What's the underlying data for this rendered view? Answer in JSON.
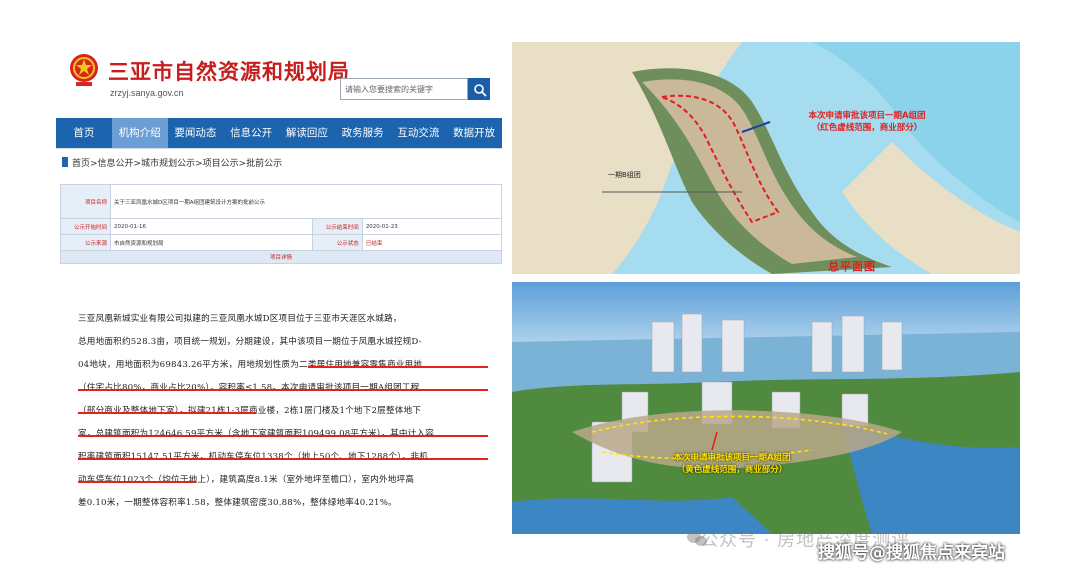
{
  "site": {
    "title": "三亚市自然资源和规划局",
    "domain": "zrzyj.sanya.gov.cn",
    "search_placeholder": "请输入您要搜索的关键字",
    "brand_color": "#c81d1d",
    "nav_color": "#1c64ad"
  },
  "nav": {
    "items": [
      "首页",
      "机构介绍",
      "要闻动态",
      "信息公开",
      "解读回应",
      "政务服务",
      "互动交流",
      "数据开放"
    ],
    "active_index": 1
  },
  "breadcrumb": "首页>信息公开>城市规划公示>项目公示>批前公示",
  "info_table": {
    "rows": [
      {
        "label": "项目名称",
        "value": "关于三亚凤凰水城D区项目一期A组团建筑设计方案的批前公示"
      },
      {
        "label": "公示开始时间",
        "value": "2020-01-16",
        "label2": "公示结束时间",
        "value2": "2020-01-23"
      },
      {
        "label": "公示来源",
        "value": "市自然资源和规划局",
        "label2": "公示状态",
        "value2": "已结束"
      }
    ],
    "detail_label": "项目详情"
  },
  "document": {
    "lines": [
      "三亚凤凰新城实业有限公司拟建的三亚凤凰水城D区项目位于三亚市天涯区水城路，",
      "总用地面积约528.3亩，项目统一规划，分期建设，其中该项目一期位于凤凰水城控规D-",
      "04地块，用地面积为69843.26平方米，用地规划性质为二类居住用地兼容零售商业用地",
      "（住宅占比80%，商业占比20%），容积率≤1.58。本次申请审批该项目一期A组团工程",
      "（部分商业及整体地下室），拟建21栋1-3层商业楼，2栋1层门楼及1个地下2层整体地下",
      "室，总建筑面积为124646.59平方米（含地下室建筑面积109499.08平方米），其中计入容",
      "积率建筑面积15147.51平方米，机动车停车位1338个（地上50个、地下1288个），非机",
      "动车停车位1023个（均位于地上），建筑高度8.1米（室外地坪至檐口），室内外地坪高",
      "差0.10米，一期整体容积率1.58，整体建筑密度30.88%，整体绿地率40.21%。"
    ]
  },
  "plan_image": {
    "caption_line1": "本次申请审批该项目一期A组团",
    "caption_line2": "（红色虚线范围，商业部分）",
    "title": "总平面图",
    "road_label": "一期B组团"
  },
  "aerial_image": {
    "caption_line1": "本次申请审批该项目一期A组团",
    "caption_line2": "（黄色虚线范围，商业部分）"
  },
  "watermarks": {
    "wechat": "公众号 · 房地产深度测评",
    "sohu": "搜狐号@搜狐焦点来宾站"
  }
}
